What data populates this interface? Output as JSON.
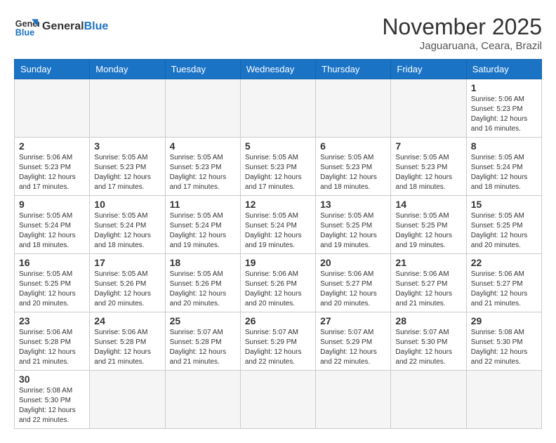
{
  "logo": {
    "text_general": "General",
    "text_blue": "Blue"
  },
  "title": {
    "month_year": "November 2025",
    "location": "Jaguaruana, Ceara, Brazil"
  },
  "weekdays": [
    "Sunday",
    "Monday",
    "Tuesday",
    "Wednesday",
    "Thursday",
    "Friday",
    "Saturday"
  ],
  "days": {
    "d1": {
      "num": "1",
      "info": "Sunrise: 5:06 AM\nSunset: 5:23 PM\nDaylight: 12 hours\nand 16 minutes."
    },
    "d2": {
      "num": "2",
      "info": "Sunrise: 5:06 AM\nSunset: 5:23 PM\nDaylight: 12 hours\nand 17 minutes."
    },
    "d3": {
      "num": "3",
      "info": "Sunrise: 5:05 AM\nSunset: 5:23 PM\nDaylight: 12 hours\nand 17 minutes."
    },
    "d4": {
      "num": "4",
      "info": "Sunrise: 5:05 AM\nSunset: 5:23 PM\nDaylight: 12 hours\nand 17 minutes."
    },
    "d5": {
      "num": "5",
      "info": "Sunrise: 5:05 AM\nSunset: 5:23 PM\nDaylight: 12 hours\nand 17 minutes."
    },
    "d6": {
      "num": "6",
      "info": "Sunrise: 5:05 AM\nSunset: 5:23 PM\nDaylight: 12 hours\nand 18 minutes."
    },
    "d7": {
      "num": "7",
      "info": "Sunrise: 5:05 AM\nSunset: 5:23 PM\nDaylight: 12 hours\nand 18 minutes."
    },
    "d8": {
      "num": "8",
      "info": "Sunrise: 5:05 AM\nSunset: 5:24 PM\nDaylight: 12 hours\nand 18 minutes."
    },
    "d9": {
      "num": "9",
      "info": "Sunrise: 5:05 AM\nSunset: 5:24 PM\nDaylight: 12 hours\nand 18 minutes."
    },
    "d10": {
      "num": "10",
      "info": "Sunrise: 5:05 AM\nSunset: 5:24 PM\nDaylight: 12 hours\nand 18 minutes."
    },
    "d11": {
      "num": "11",
      "info": "Sunrise: 5:05 AM\nSunset: 5:24 PM\nDaylight: 12 hours\nand 19 minutes."
    },
    "d12": {
      "num": "12",
      "info": "Sunrise: 5:05 AM\nSunset: 5:24 PM\nDaylight: 12 hours\nand 19 minutes."
    },
    "d13": {
      "num": "13",
      "info": "Sunrise: 5:05 AM\nSunset: 5:25 PM\nDaylight: 12 hours\nand 19 minutes."
    },
    "d14": {
      "num": "14",
      "info": "Sunrise: 5:05 AM\nSunset: 5:25 PM\nDaylight: 12 hours\nand 19 minutes."
    },
    "d15": {
      "num": "15",
      "info": "Sunrise: 5:05 AM\nSunset: 5:25 PM\nDaylight: 12 hours\nand 20 minutes."
    },
    "d16": {
      "num": "16",
      "info": "Sunrise: 5:05 AM\nSunset: 5:25 PM\nDaylight: 12 hours\nand 20 minutes."
    },
    "d17": {
      "num": "17",
      "info": "Sunrise: 5:05 AM\nSunset: 5:26 PM\nDaylight: 12 hours\nand 20 minutes."
    },
    "d18": {
      "num": "18",
      "info": "Sunrise: 5:05 AM\nSunset: 5:26 PM\nDaylight: 12 hours\nand 20 minutes."
    },
    "d19": {
      "num": "19",
      "info": "Sunrise: 5:06 AM\nSunset: 5:26 PM\nDaylight: 12 hours\nand 20 minutes."
    },
    "d20": {
      "num": "20",
      "info": "Sunrise: 5:06 AM\nSunset: 5:27 PM\nDaylight: 12 hours\nand 20 minutes."
    },
    "d21": {
      "num": "21",
      "info": "Sunrise: 5:06 AM\nSunset: 5:27 PM\nDaylight: 12 hours\nand 21 minutes."
    },
    "d22": {
      "num": "22",
      "info": "Sunrise: 5:06 AM\nSunset: 5:27 PM\nDaylight: 12 hours\nand 21 minutes."
    },
    "d23": {
      "num": "23",
      "info": "Sunrise: 5:06 AM\nSunset: 5:28 PM\nDaylight: 12 hours\nand 21 minutes."
    },
    "d24": {
      "num": "24",
      "info": "Sunrise: 5:06 AM\nSunset: 5:28 PM\nDaylight: 12 hours\nand 21 minutes."
    },
    "d25": {
      "num": "25",
      "info": "Sunrise: 5:07 AM\nSunset: 5:28 PM\nDaylight: 12 hours\nand 21 minutes."
    },
    "d26": {
      "num": "26",
      "info": "Sunrise: 5:07 AM\nSunset: 5:29 PM\nDaylight: 12 hours\nand 22 minutes."
    },
    "d27": {
      "num": "27",
      "info": "Sunrise: 5:07 AM\nSunset: 5:29 PM\nDaylight: 12 hours\nand 22 minutes."
    },
    "d28": {
      "num": "28",
      "info": "Sunrise: 5:07 AM\nSunset: 5:30 PM\nDaylight: 12 hours\nand 22 minutes."
    },
    "d29": {
      "num": "29",
      "info": "Sunrise: 5:08 AM\nSunset: 5:30 PM\nDaylight: 12 hours\nand 22 minutes."
    },
    "d30": {
      "num": "30",
      "info": "Sunrise: 5:08 AM\nSunset: 5:30 PM\nDaylight: 12 hours\nand 22 minutes."
    }
  }
}
